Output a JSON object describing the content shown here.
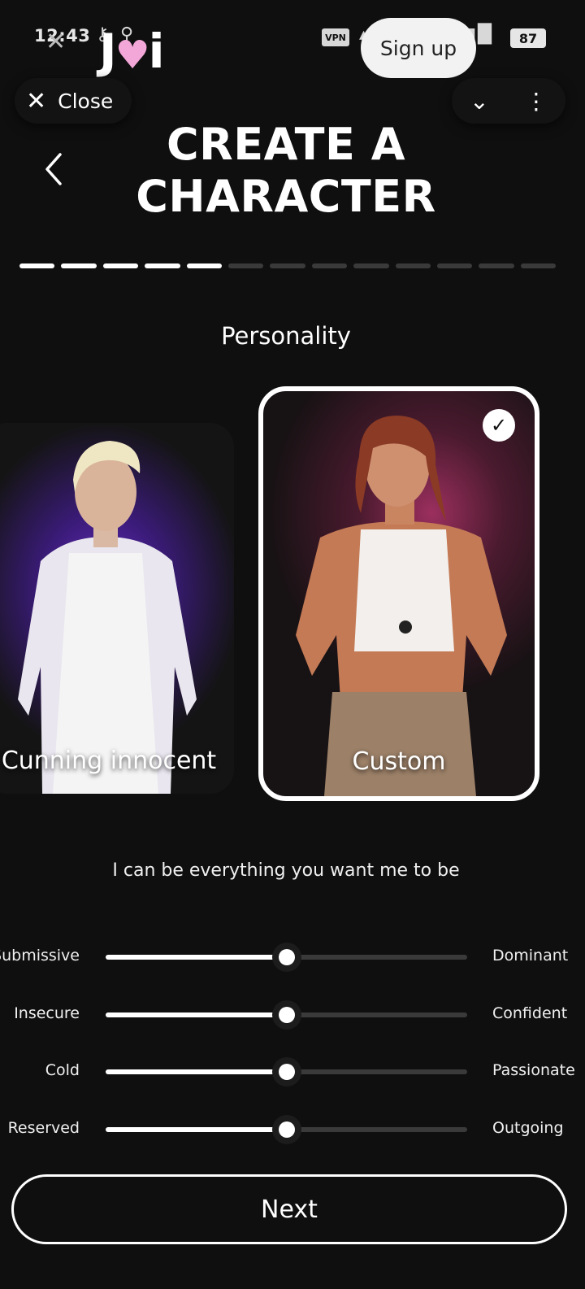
{
  "status_bar": {
    "time": "12:43",
    "vpn": "VPN",
    "battery": "87",
    "icons": [
      "key-icon",
      "search-icon",
      "vpn-icon",
      "signal-icon",
      "wifi-icon",
      "battery-icon"
    ]
  },
  "header": {
    "signup_label": "Sign up",
    "close_label": "Close",
    "title_line1": "CREATE A",
    "title_line2": "CHARACTER"
  },
  "progress": {
    "total_steps": 13,
    "completed_steps": 5
  },
  "section": {
    "title": "Personality"
  },
  "cards": [
    {
      "label": "Cunning innocent",
      "selected": false
    },
    {
      "label": "Custom",
      "selected": true
    }
  ],
  "tagline": "I can be everything you want me to be",
  "sliders": [
    {
      "left": "Submissive",
      "right": "Dominant",
      "value": 0.5
    },
    {
      "left": "Insecure",
      "right": "Confident",
      "value": 0.5
    },
    {
      "left": "Cold",
      "right": "Passionate",
      "value": 0.5
    },
    {
      "left": "Reserved",
      "right": "Outgoing",
      "value": 0.5
    }
  ],
  "next_label": "Next",
  "colors": {
    "background": "#0f0f0f",
    "accent": "#ffffff",
    "logo_heart": "#f3a6d8"
  }
}
